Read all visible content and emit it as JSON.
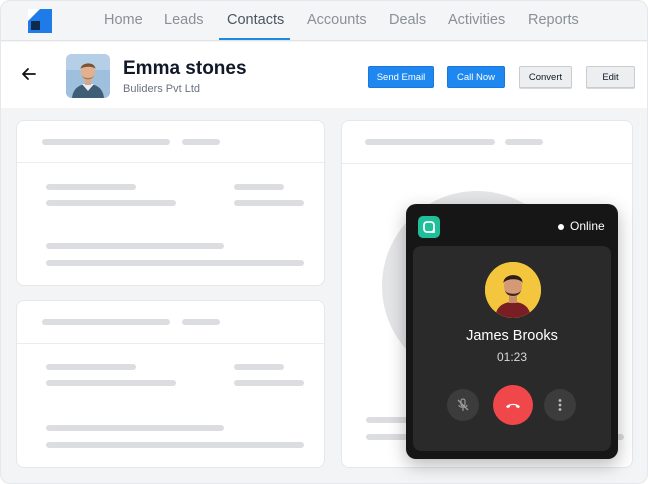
{
  "nav": {
    "items": [
      {
        "label": "Home"
      },
      {
        "label": "Leads"
      },
      {
        "label": "Contacts"
      },
      {
        "label": "Accounts"
      },
      {
        "label": "Deals"
      },
      {
        "label": "Activities"
      },
      {
        "label": "Reports"
      }
    ],
    "active": "Contacts"
  },
  "header": {
    "name": "Emma stones",
    "company": "Buliders Pvt Ltd",
    "buttons": {
      "send_email": "Send Email",
      "call_now": "Call Now",
      "convert": "Convert",
      "edit": "Edit"
    }
  },
  "call": {
    "status": "Online",
    "caller_name": "James Brooks",
    "duration": "01:23",
    "icons": {
      "mute": "mic-off-icon",
      "hangup": "phone-hangup-icon",
      "more": "more-vertical-icon"
    }
  },
  "colors": {
    "accent": "#1e88f0",
    "hangup": "#f0474a",
    "app_icon": "#1fbf9a",
    "caller_avatar_bg": "#f3c63d"
  }
}
